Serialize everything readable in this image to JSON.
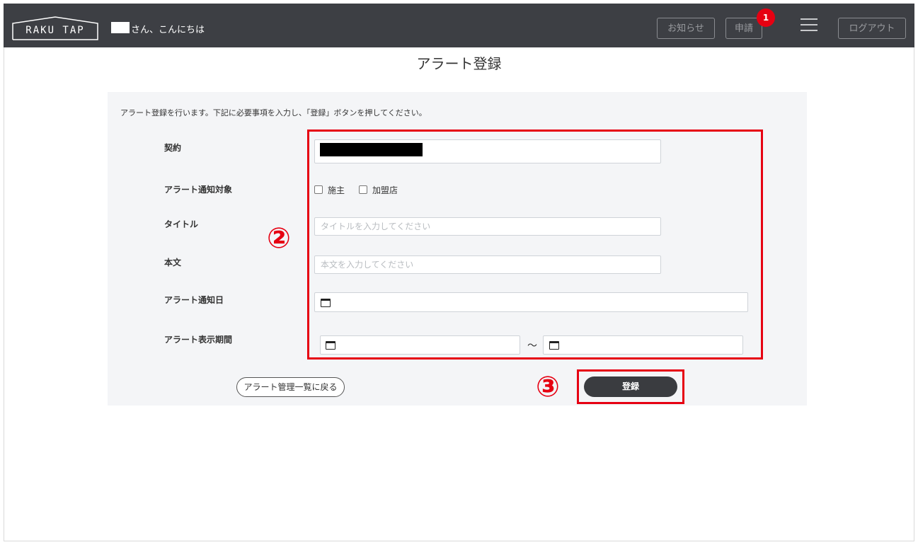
{
  "header": {
    "logo_text": "RAKU TAP",
    "greeting": "さん、こんにちは",
    "buttons": {
      "notice": "お知らせ",
      "request": "申請",
      "logout": "ログアウト"
    },
    "request_badge": "1",
    "icons": [
      "menu-icon"
    ]
  },
  "page": {
    "title": "アラート登録",
    "instruction": "アラート登録を行います。下記に必要事項を入力し、「登録」ボタンを押してください。"
  },
  "form": {
    "contract": {
      "label": "契約"
    },
    "target": {
      "label": "アラート通知対象",
      "options": [
        "施主",
        "加盟店"
      ]
    },
    "title": {
      "label": "タイトル",
      "placeholder": "タイトルを入力してください"
    },
    "body": {
      "label": "本文",
      "placeholder": "本文を入力してください"
    },
    "notify_date": {
      "label": "アラート通知日"
    },
    "display_period": {
      "label": "アラート表示期間",
      "separator": "～"
    }
  },
  "actions": {
    "back": "アラート管理一覧に戻る",
    "register": "登録"
  },
  "annotations": {
    "step2": "②",
    "step3": "③",
    "highlight_color": "#e60012"
  }
}
